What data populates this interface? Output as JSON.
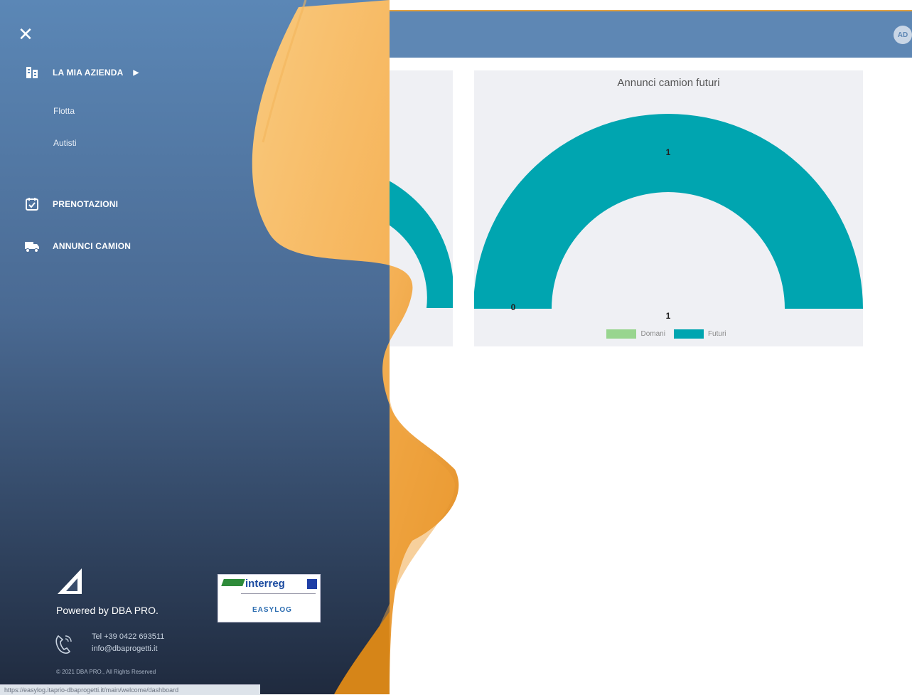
{
  "topbar": {
    "avatar_text": "AD"
  },
  "drawer": {
    "close_icon": "close-icon",
    "menu": [
      {
        "label": "LA MIA AZIENDA",
        "icon": "building-icon",
        "expanded": true,
        "children": [
          {
            "label": "Flotta"
          },
          {
            "label": "Autisti"
          }
        ]
      },
      {
        "label": "PRENOTAZIONI",
        "icon": "calendar-check-icon"
      },
      {
        "label": "ANNUNCI CAMION",
        "icon": "truck-icon"
      }
    ],
    "footer": {
      "powered_by": "Powered by DBA PRO.",
      "phone": "Tel +39 0422 693511",
      "email": "info@dbaprogetti.it",
      "copyright": "© 2021 DBA PRO., All Rights Reserved",
      "partner_logo": {
        "brand": "interreg",
        "project": "EASYLOG"
      }
    }
  },
  "status_url": "https://easylog.itaprio-dbaprogetti.it/main/welcome/dashboard",
  "colors": {
    "teal": "#00a5b0",
    "green": "#98d58f",
    "topbar": "#5e87b4"
  },
  "chart_data": [
    {
      "type": "pie",
      "title": "Annunci camion futuri",
      "series": [
        {
          "name": "Domani",
          "value": 0,
          "color": "#98d58f"
        },
        {
          "name": "Futuri",
          "value": 1,
          "color": "#00a5b0"
        }
      ],
      "data_labels": [
        "0",
        "1"
      ],
      "total_label": "1",
      "legend": "bottom"
    }
  ]
}
